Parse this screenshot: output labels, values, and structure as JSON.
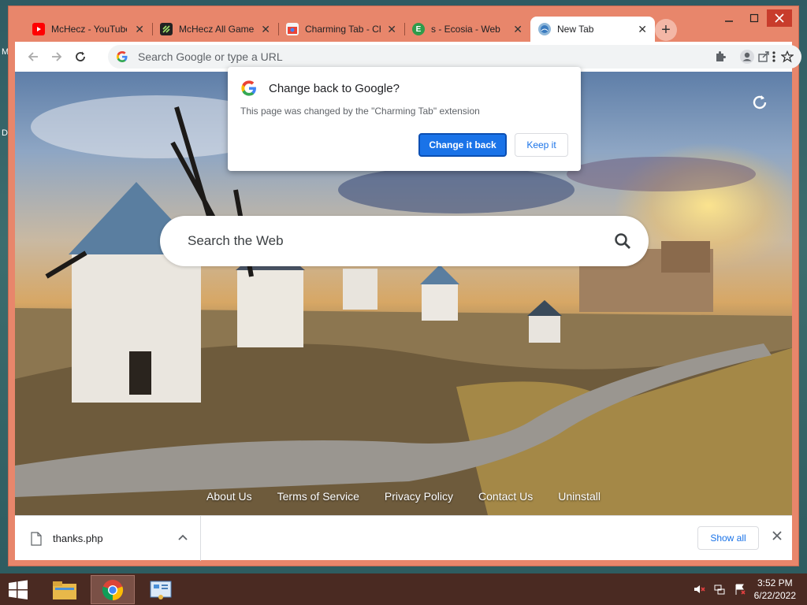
{
  "desktop": {
    "edge_letters": [
      "M",
      "D"
    ]
  },
  "tabs": [
    {
      "title": "McHecz - YouTube",
      "favicon": "youtube-icon",
      "color": "#ff0000"
    },
    {
      "title": "McHecz All Games",
      "favicon": "game-logo-icon",
      "color": "#222222"
    },
    {
      "title": "Charming Tab - Chrome",
      "favicon": "chrome-web-store-icon",
      "color": "#ea4335"
    },
    {
      "title": "s - Ecosia - Web",
      "favicon": "ecosia-icon",
      "color": "#2e9b4a"
    },
    {
      "title": "New Tab",
      "favicon": "charming-tab-icon",
      "color": "#3a7bbf"
    }
  ],
  "toolbar": {
    "omnibox_placeholder": "Search Google or type a URL"
  },
  "popup": {
    "title": "Change back to Google?",
    "text": "This page was changed by the \"Charming Tab\" extension",
    "primary_button": "Change it back",
    "secondary_button": "Keep it"
  },
  "newtab": {
    "search_placeholder": "Search the Web",
    "footer_links": [
      "About Us",
      "Terms of Service",
      "Privacy Policy",
      "Contact Us",
      "Uninstall"
    ]
  },
  "download_bar": {
    "filename": "thanks.php",
    "show_all": "Show all"
  },
  "taskbar": {
    "time": "3:52 PM",
    "date": "6/22/2022"
  },
  "colors": {
    "frame": "#e8866b",
    "accent": "#1a73e8",
    "taskbar": "#4a2a22"
  }
}
